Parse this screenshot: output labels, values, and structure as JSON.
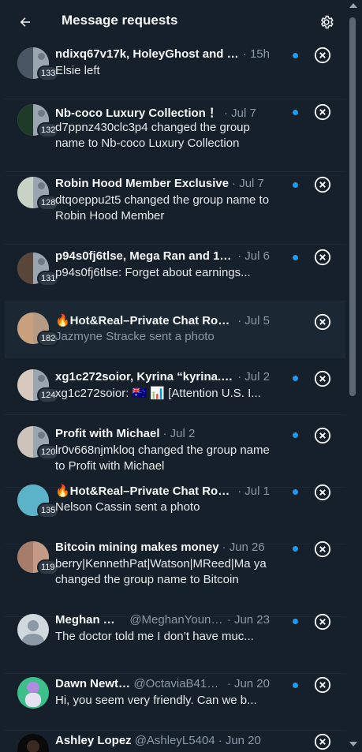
{
  "header": {
    "title": "Message requests",
    "back_icon": "arrow-left-icon",
    "settings_icon": "gear-icon"
  },
  "colors": {
    "background": "#15202b",
    "unread_dot": "#1d9bf0",
    "secondary_text": "#8b98a5"
  },
  "conversations": [
    {
      "name": "ndixq67v17k, HoleyGhost and 131 ...",
      "handle": "",
      "time": "· 15h",
      "preview": "Elsie left",
      "count": "133",
      "unread": true
    },
    {
      "name": "Nb-coco Luxury Collection ！",
      "handle": "",
      "time": "· Jul 7",
      "preview": "d7ppnz430clc3p4 changed the group name to Nb-coco Luxury Collection",
      "count": "132",
      "unread": true
    },
    {
      "name": "Robin Hood Member Exclusive",
      "handle": "",
      "time": "· Jul 7",
      "preview": "dtqoeppu2t5 changed the group name to Robin Hood Member",
      "count": "128",
      "unread": true
    },
    {
      "name": "p94s0fj6tlse, Mega Ran and 129 ...",
      "handle": "",
      "time": "· Jul 6",
      "preview": "p94s0fj6tlse: Forget about earnings...",
      "count": "131",
      "unread": true
    },
    {
      "name": "🔥Hot&Real–Private Chat Room",
      "handle": "",
      "time": "· Jul 5",
      "preview": "Jazmyne Stracke sent a photo",
      "count": "182",
      "unread": false
    },
    {
      "name": "xg1c272soior, Kyrina “kyrina.bsk...",
      "handle": "",
      "time": "· Jul 2",
      "preview": "xg1c272soior: 🇦🇺 📊 [Attention U.S. I...",
      "count": "124",
      "unread": true
    },
    {
      "name": "Profit with Michael",
      "handle": "",
      "time": "· Jul 2",
      "preview": "lr0v668njmkloq changed the group name to Profit with Michael",
      "count": "120",
      "unread": true
    },
    {
      "name": "🔥Hot&Real–Private Chat Room",
      "handle": "",
      "time": "· Jul 1",
      "preview": "Nelson Cassin sent a photo",
      "count": "135",
      "unread": true
    },
    {
      "name": "Bitcoin mining makes money",
      "handle": "",
      "time": "· Jun 26",
      "preview": "berry|KennethPat|Watson|MReed|Ma ya changed the group name to Bitcoin",
      "count": "119",
      "unread": true
    },
    {
      "name": "Meghan Yo...",
      "handle": "@MeghanYoun46...",
      "time": "· Jun 23",
      "preview": "The doctor told me I don’t have muc...",
      "count": "",
      "unread": true
    },
    {
      "name": "Dawn Newton",
      "handle": "@OctaviaB41639",
      "time": "· Jun 20",
      "preview": "Hi, you seem very friendly. Can we b...",
      "count": "",
      "unread": true
    },
    {
      "name": "Ashley Lopez",
      "handle": "@AshleyL5404",
      "time": "· Jun 20",
      "preview": "",
      "count": "",
      "unread": true
    }
  ]
}
